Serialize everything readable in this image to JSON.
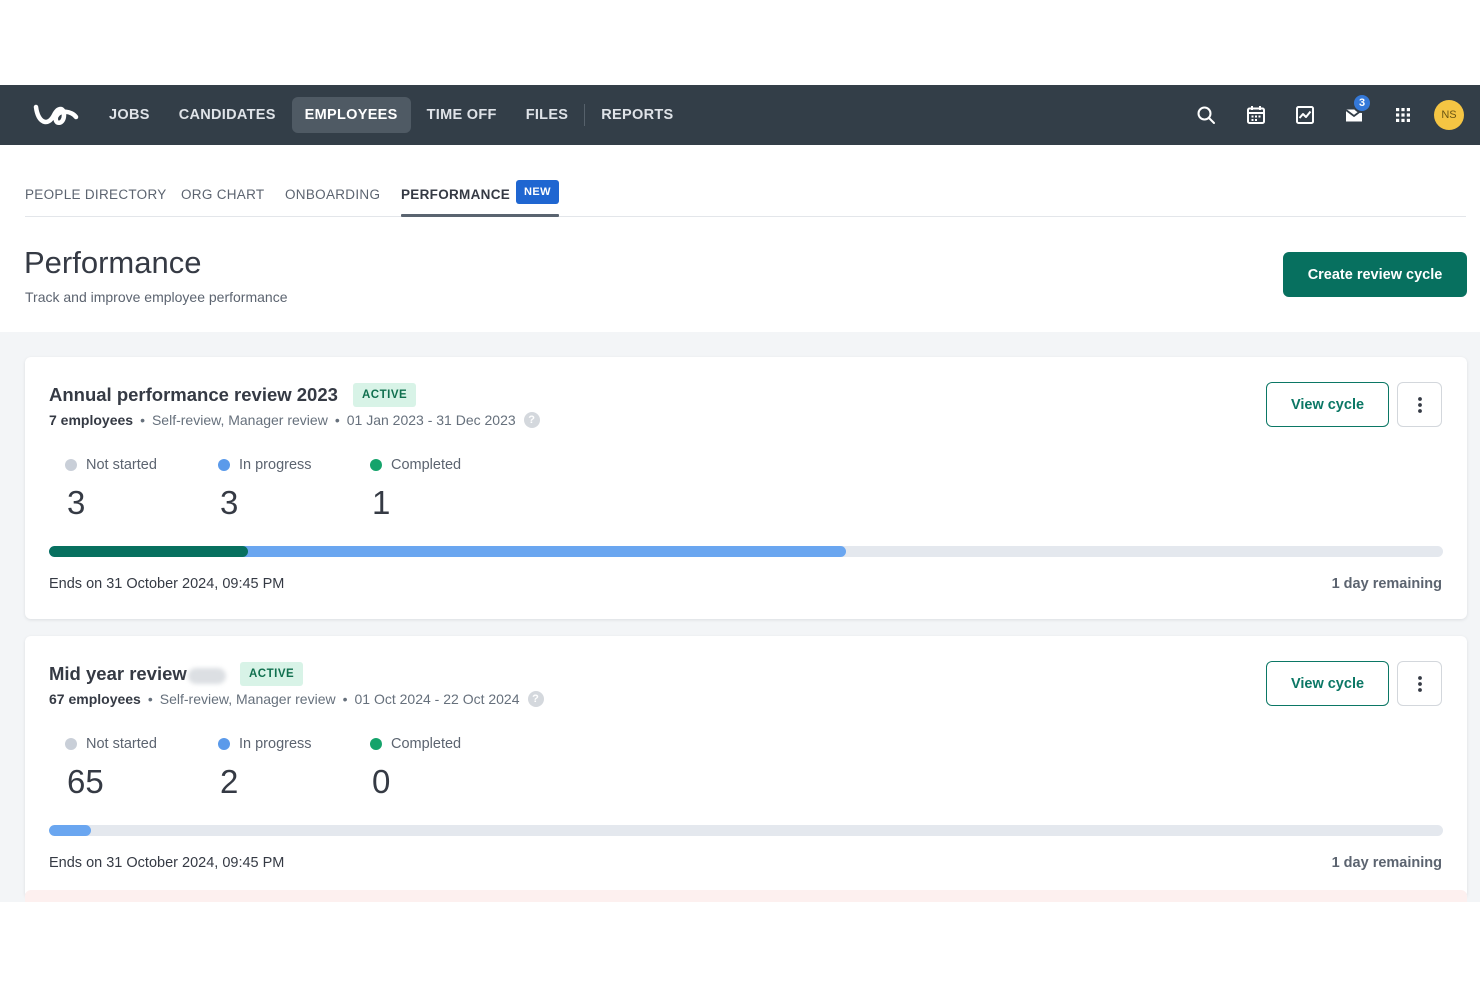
{
  "brand": {
    "accent": "#07705f",
    "nav_bg": "#333e48",
    "logo_icon": "workable-logo-icon"
  },
  "topnav": {
    "items": [
      {
        "label": "JOBS"
      },
      {
        "label": "CANDIDATES"
      },
      {
        "label": "EMPLOYEES",
        "active": true
      },
      {
        "label": "TIME OFF"
      },
      {
        "label": "FILES"
      },
      {
        "label": "REPORTS"
      }
    ],
    "icons": [
      "search-icon",
      "calendar-icon",
      "activity-icon",
      "inbox-icon",
      "apps-grid-icon"
    ],
    "inbox_badge": "3",
    "avatar_initials": "NS"
  },
  "subtabs": [
    {
      "label": "PEOPLE DIRECTORY"
    },
    {
      "label": "ORG CHART"
    },
    {
      "label": "ONBOARDING"
    },
    {
      "label": "PERFORMANCE",
      "active": true,
      "badge": "NEW"
    }
  ],
  "page": {
    "title": "Performance",
    "subtitle": "Track and improve employee performance",
    "create_button": "Create review cycle"
  },
  "legend": {
    "not_started": "Not started",
    "in_progress": "In progress",
    "completed": "Completed"
  },
  "status_colors": {
    "not_started": "#c9cfd8",
    "in_progress": "#5b9aea",
    "completed": "#15a36b"
  },
  "cycles": [
    {
      "title": "Annual performance review 2023",
      "status": "ACTIVE",
      "employees": "7 employees",
      "review_types": "Self-review, Manager review",
      "date_range": "01 Jan 2023 - 31 Dec 2023",
      "counts": {
        "not_started": "3",
        "in_progress": "3",
        "completed": "1"
      },
      "progress": {
        "completed_fraction": 0.1429,
        "in_progress_fraction": 0.4286
      },
      "ends": "Ends on 31 October 2024, 09:45 PM",
      "remaining": "1 day remaining",
      "view_button": "View cycle"
    },
    {
      "title": "Mid year review",
      "status": "ACTIVE",
      "employees": "67 employees",
      "review_types": "Self-review, Manager review",
      "date_range": "01 Oct 2024 - 22 Oct 2024",
      "counts": {
        "not_started": "65",
        "in_progress": "2",
        "completed": "0"
      },
      "progress": {
        "completed_fraction": 0,
        "in_progress_fraction": 0.0299
      },
      "ends": "Ends on 31 October 2024, 09:45 PM",
      "remaining": "1 day remaining",
      "view_button": "View cycle"
    }
  ]
}
